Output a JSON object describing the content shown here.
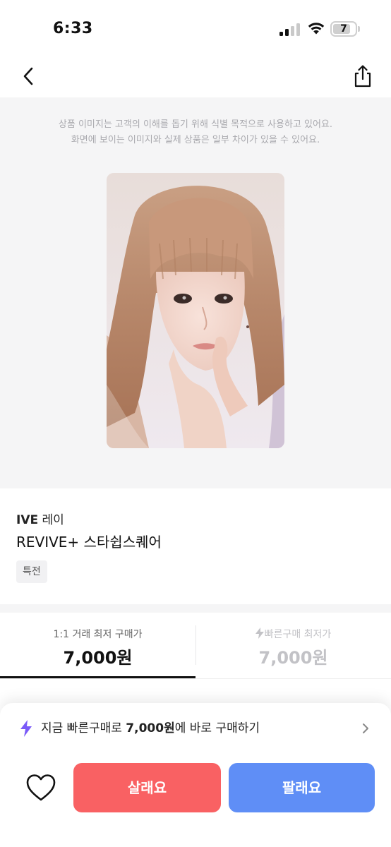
{
  "status_bar": {
    "time": "6:33",
    "battery_level": "7",
    "icons": [
      "cellular-signal-icon",
      "wifi-icon",
      "battery-icon"
    ]
  },
  "nav": {
    "icons": [
      "back-arrow-icon",
      "share-icon"
    ]
  },
  "image_notice": {
    "line1": "상품 이미지는 고객의 이해를 돕기 위해 식별 목적으로 사용하고 있어요.",
    "line2": "화면에 보이는 이미지와 실제 상품은 일부 차이가 있을 수 있어요."
  },
  "product": {
    "group": "IVE",
    "member": "레이",
    "title": "REVIVE+ 스타쉽스퀘어",
    "tag": "특전"
  },
  "price_tabs": [
    {
      "label": "1:1 거래 최저 구매가",
      "value": "7,000원",
      "active": true
    },
    {
      "label": "빠른구매 최저가",
      "value": "7,000원",
      "active": false,
      "icon": "lightning-icon"
    }
  ],
  "quick_buy": {
    "prefix": "지금 빠른구매로 ",
    "price": "7,000원",
    "suffix": "에 바로 구매하기",
    "icon": "lightning-icon"
  },
  "actions": {
    "buy_label": "살래요",
    "sell_label": "팔래요",
    "icon": "heart-icon"
  },
  "colors": {
    "buy": "#f96163",
    "sell": "#5f8ef6",
    "accent": "#7a5af8",
    "image_bg": "#f5f5f6"
  }
}
